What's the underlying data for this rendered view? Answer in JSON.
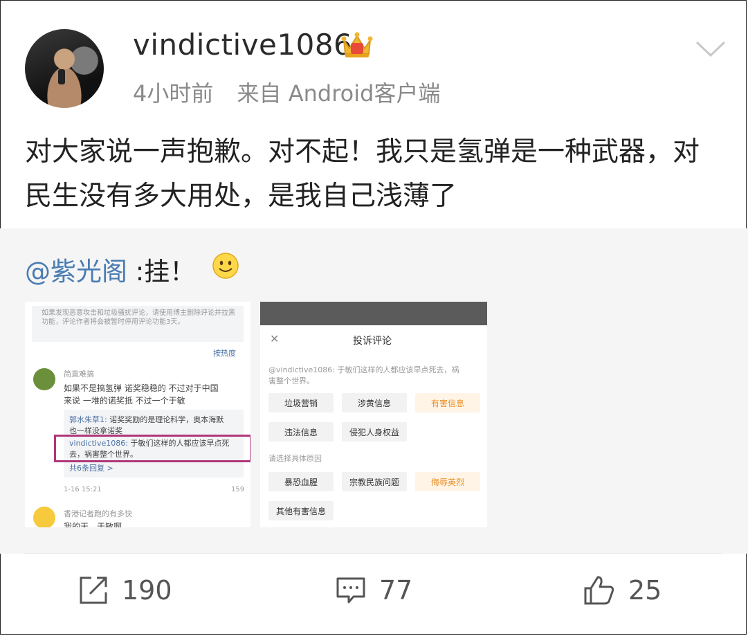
{
  "post": {
    "username": "vindictive1086",
    "time": "4小时前",
    "source": "来自 Android客户端",
    "text": "对大家说一声抱歉。对不起！我只是氢弹是一种武器，对民生没有多大用处，是我自己浅薄了"
  },
  "repost": {
    "mention": "@紫光阁",
    "text": " :挂！"
  },
  "image1": {
    "notice": "如果发现恶意攻击和垃圾骚扰评论，请使用博主删除评论并拉黑功能，评论作者将会被暂时停用评论功能3天。",
    "sort": "按热度",
    "comment1_user": "简直难搞",
    "comment1_text_1": "如果不是搞氢弹 诺奖稳稳的 不过对于中国",
    "comment1_text_2": "来说 一堆的诺奖抵 不过一个于敏",
    "reply1_user": "郭水朱草1:",
    "reply1_text_1": " 诺奖奖励的是理论科学，奥本海默",
    "reply1_text_2": "也一样没拿诺奖",
    "reply2_user": "vindictive1086:",
    "reply2_text_1": " 于敏们这样的人都应该早点死",
    "reply2_text_2": "去，祸害整个世界。",
    "more_replies": "共6条回复 >",
    "date": "1-16 15:21",
    "likes": "159",
    "comment2_user": "香港记者跑的有多快",
    "comment2_text": "我的天，于敏啊"
  },
  "image2": {
    "title": "投诉评论",
    "quoted_user": "@vindictive1086:",
    "quoted_text_1": " 于敏们这样的人都应该早点死去，祸",
    "quoted_text_2": "害整个世界。",
    "options_row1": [
      "垃圾营销",
      "涉黄信息",
      "有害信息"
    ],
    "options_row2": [
      "违法信息",
      "侵犯人身权益"
    ],
    "reason_label": "请选择具体原因",
    "options_row3": [
      "暴恐血腥",
      "宗教民族问题",
      "侮辱英烈"
    ],
    "options_row4": [
      "其他有害信息"
    ]
  },
  "actions": {
    "repost_count": "190",
    "comment_count": "77",
    "like_count": "25"
  },
  "colors": {
    "link": "#4a7cb2",
    "highlight_border": "#b0367a",
    "orange": "#e8912b"
  },
  "icons": [
    "crown-icon",
    "chevron-down-icon",
    "smiley-icon",
    "repost-icon",
    "comment-icon",
    "like-icon"
  ]
}
